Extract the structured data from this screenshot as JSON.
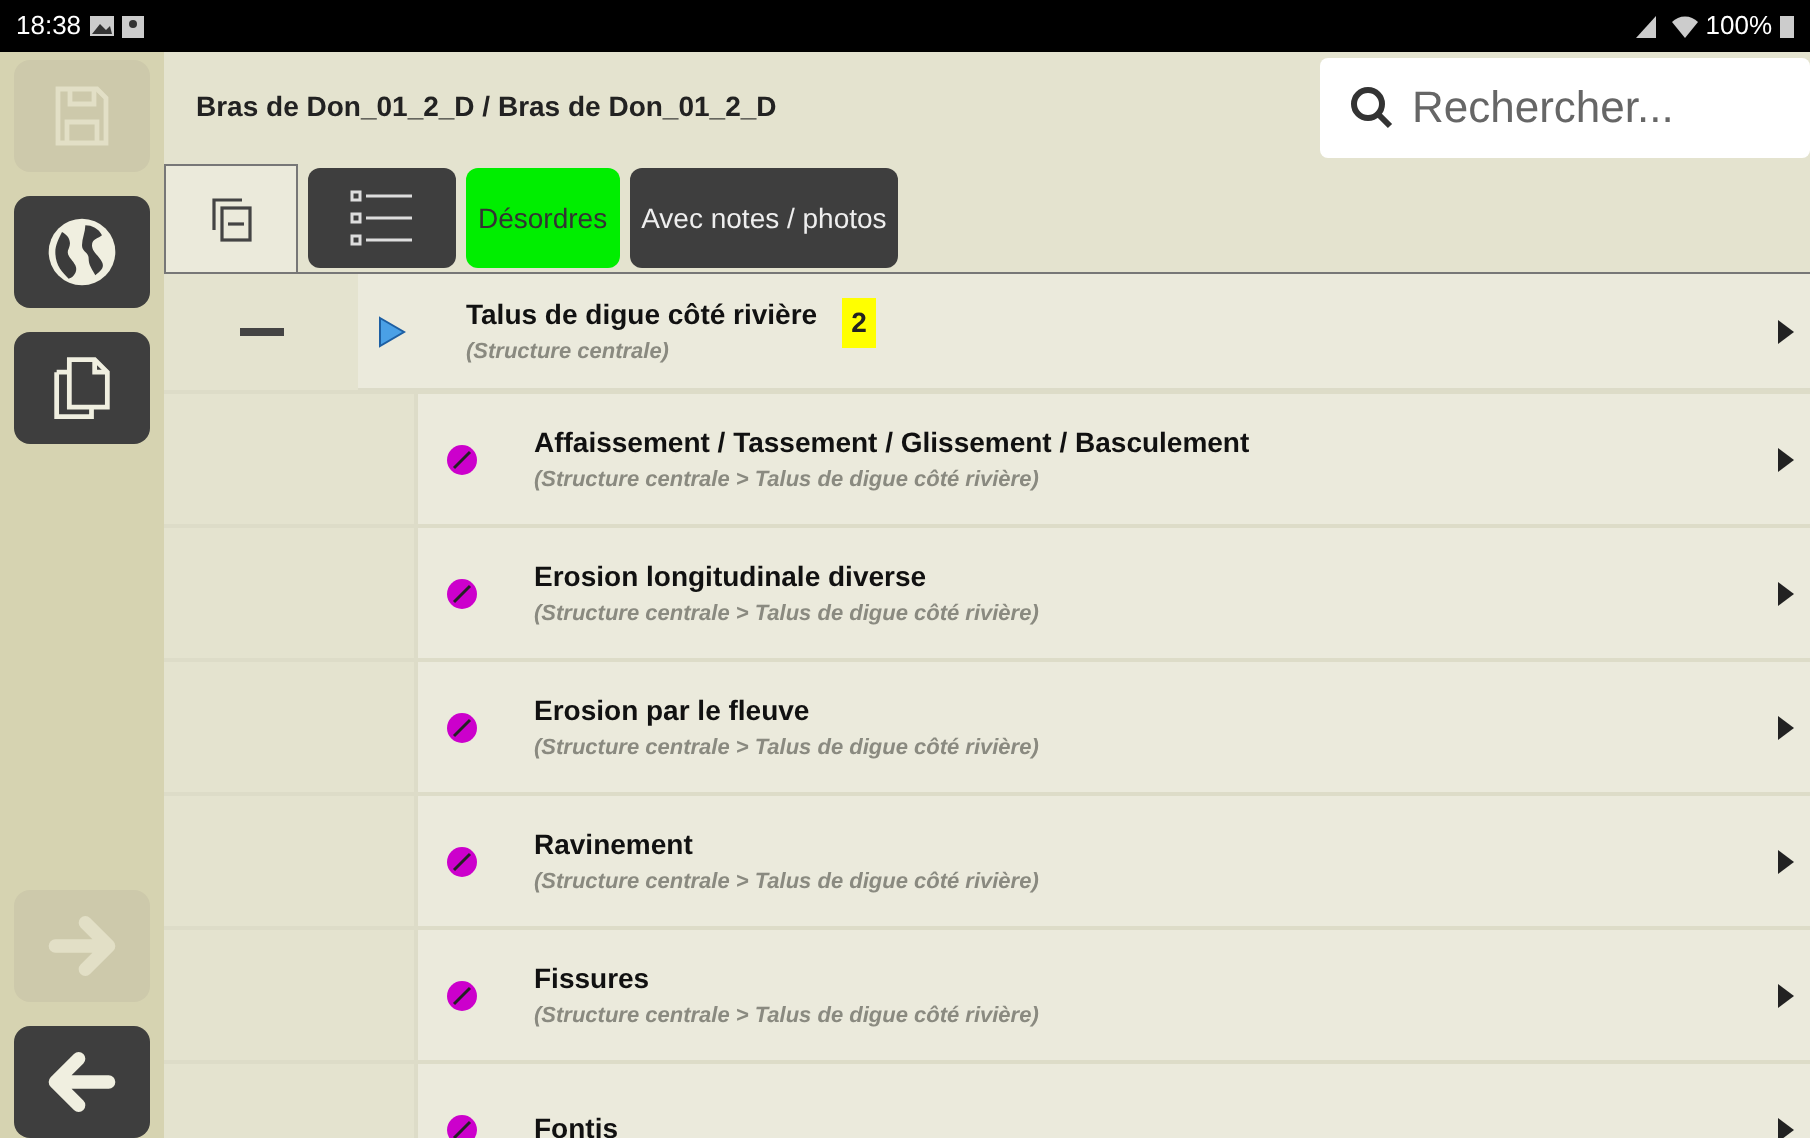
{
  "status_bar": {
    "time": "18:38",
    "battery": "100%"
  },
  "sidebar": {
    "items": [
      {
        "kind": "save",
        "disabled": true
      },
      {
        "kind": "globe",
        "disabled": false
      },
      {
        "kind": "copy",
        "disabled": false
      },
      {
        "kind": "forward",
        "disabled": true
      },
      {
        "kind": "back",
        "disabled": false
      }
    ]
  },
  "header": {
    "title": "Bras de Don_01_2_D / Bras de Don_01_2_D",
    "search": {
      "placeholder": "Rechercher..."
    }
  },
  "toolbar": {
    "filters": [
      {
        "label": "Désordres",
        "selected": true
      },
      {
        "label": "Avec notes / photos",
        "selected": false
      }
    ]
  },
  "tree": {
    "group": {
      "title": "Talus de digue côté rivière",
      "subtitle": "(Structure centrale)",
      "count": "2",
      "expanded": true
    },
    "children": [
      {
        "title": "Affaissement / Tassement / Glissement / Basculement",
        "subtitle": "(Structure centrale > Talus de digue côté rivière)"
      },
      {
        "title": "Erosion longitudinale diverse",
        "subtitle": "(Structure centrale > Talus de digue côté rivière)"
      },
      {
        "title": "Erosion par le fleuve",
        "subtitle": "(Structure centrale > Talus de digue côté rivière)"
      },
      {
        "title": "Ravinement",
        "subtitle": "(Structure centrale > Talus de digue côté rivière)"
      },
      {
        "title": "Fissures",
        "subtitle": "(Structure centrale > Talus de digue côté rivière)"
      },
      {
        "title": "Fontis"
      }
    ]
  }
}
